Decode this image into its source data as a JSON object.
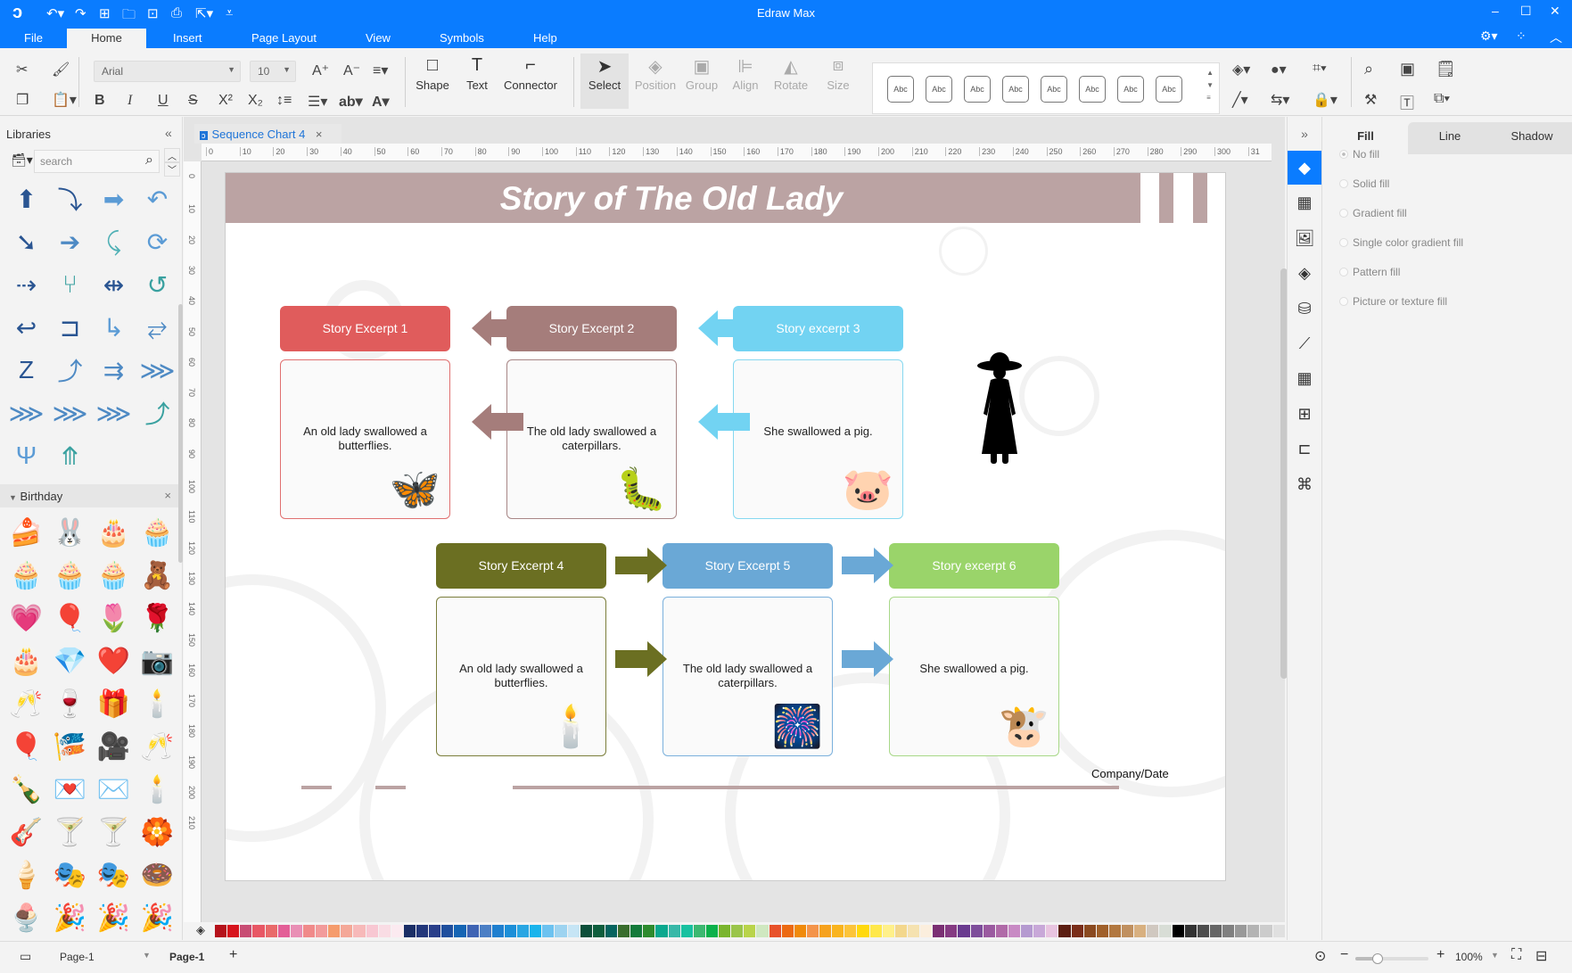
{
  "app": {
    "title": "Edraw Max"
  },
  "quick_access": [
    "app-logo-icon",
    "undo-icon",
    "redo-icon",
    "new-icon",
    "open-icon",
    "save-icon",
    "print-icon",
    "export-icon",
    "customize-icon"
  ],
  "menu": {
    "tabs": [
      "File",
      "Home",
      "Insert",
      "Page Layout",
      "View",
      "Symbols",
      "Help"
    ],
    "active": "Home"
  },
  "ribbon": {
    "font_name": "Arial",
    "font_size": "10",
    "tools": [
      {
        "label": "Shape",
        "glyph": "□",
        "enabled": true
      },
      {
        "label": "Text",
        "glyph": "T",
        "enabled": true
      },
      {
        "label": "Connector",
        "glyph": "⌐",
        "enabled": true
      },
      {
        "label": "Select",
        "glyph": "➤",
        "enabled": true
      },
      {
        "label": "Position",
        "glyph": "◈",
        "enabled": false
      },
      {
        "label": "Group",
        "glyph": "▣",
        "enabled": false
      },
      {
        "label": "Align",
        "glyph": "⊫",
        "enabled": false
      },
      {
        "label": "Rotate",
        "glyph": "◭",
        "enabled": false
      },
      {
        "label": "Size",
        "glyph": "⧈",
        "enabled": false
      }
    ],
    "style_preview_label": "Abc",
    "style_preview_count": 8
  },
  "libraries": {
    "title": "Libraries",
    "search_placeholder": "search",
    "arrows_section_count": 26,
    "birthday": {
      "title": "Birthday",
      "items": [
        "🍰",
        "🐰",
        "🎂",
        "🧁",
        "🧁",
        "🧁",
        "🧁",
        "🧸",
        "💗",
        "🎈",
        "🌷",
        "🌹",
        "🎂",
        "💎",
        "❤️",
        "📷",
        "🥂",
        "🍷",
        "🎁",
        "🕯️",
        "🎈",
        "🎏",
        "🎥",
        "🥂",
        "🍾",
        "💌",
        "✉️",
        "🕯️",
        "🎸",
        "🍸",
        "🍸",
        "🏵️",
        "🍦",
        "🎭",
        "🎭",
        "🍩",
        "🍨",
        "🎉",
        "🎉",
        "🎉"
      ]
    }
  },
  "document": {
    "tab_label": "Sequence Chart 4"
  },
  "rulers": {
    "horizontal": [
      "0",
      "10",
      "20",
      "30",
      "40",
      "50",
      "60",
      "70",
      "80",
      "90",
      "100",
      "110",
      "120",
      "130",
      "140",
      "150",
      "160",
      "170",
      "180",
      "190",
      "200",
      "210",
      "220",
      "230",
      "240",
      "250",
      "260",
      "270",
      "280",
      "290",
      "300",
      "31"
    ],
    "vertical": [
      "0",
      "10",
      "20",
      "30",
      "40",
      "50",
      "60",
      "70",
      "80",
      "90",
      "100",
      "110",
      "120",
      "130",
      "140",
      "150",
      "160",
      "170",
      "180",
      "190",
      "200",
      "210"
    ]
  },
  "diagram": {
    "title": "Story of The Old Lady",
    "band_color": "#bba3a3",
    "footer": "Company/Date",
    "row1": [
      {
        "header": "Story Excerpt 1",
        "text": "An old lady swallowed a butterflies.",
        "color": "#e05c5c",
        "border": "#e07070",
        "pic": "🦋"
      },
      {
        "header": "Story Excerpt 2",
        "text": "The old lady swallowed a caterpillars.",
        "color": "#a57d7b",
        "border": "#a88686",
        "pic": "🐛"
      },
      {
        "header": "Story excerpt 3",
        "text": "She swallowed a pig.",
        "color": "#72d3f2",
        "border": "#86d8f0",
        "pic": "🐷"
      }
    ],
    "row2": [
      {
        "header": "Story Excerpt 4",
        "text": "An old lady swallowed a butterflies.",
        "color": "#6b6f22",
        "border": "#7a7d3a",
        "pic": "🕯️"
      },
      {
        "header": "Story Excerpt 5",
        "text": "The old lady swallowed a caterpillars.",
        "color": "#6aa8d6",
        "border": "#7ab0dc",
        "pic": "🎆"
      },
      {
        "header": "Story excerpt 6",
        "text": "She swallowed a pig.",
        "color": "#9ad46a",
        "border": "#a8d888",
        "pic": "🐮"
      }
    ],
    "figure_icon": "old-lady-silhouette"
  },
  "right_strip_icons": [
    "fill-icon",
    "grid-icon",
    "image-icon",
    "layers-icon",
    "database-icon",
    "chart-icon",
    "table-icon",
    "org-icon",
    "timeline-icon",
    "mindmap-icon"
  ],
  "properties": {
    "tabs": [
      "Fill",
      "Line",
      "Shadow"
    ],
    "active_tab": "Fill",
    "fill_options": [
      "No fill",
      "Solid fill",
      "Gradient fill",
      "Single color gradient fill",
      "Pattern fill",
      "Picture or texture fill"
    ],
    "selected_fill": "No fill"
  },
  "palette": [
    "#b5121b",
    "#d7141d",
    "#c84d74",
    "#e85765",
    "#e96a6a",
    "#e35f97",
    "#e98fb5",
    "#f08a8a",
    "#f29b9b",
    "#f59c6d",
    "#f4a898",
    "#f7b9b9",
    "#f8c7d2",
    "#f9dce4",
    "#fbeaf0",
    "#1b2e66",
    "#23377b",
    "#2a3f8a",
    "#1f4f9e",
    "#1565b4",
    "#3f64b4",
    "#4b7fc5",
    "#1f7fcf",
    "#1c8fd8",
    "#29a6e3",
    "#1ab4ec",
    "#6cc2f0",
    "#9dd3f0",
    "#c6e5f5",
    "#0d4f3a",
    "#0e5e3d",
    "#06645f",
    "#3a6e2e",
    "#137a3a",
    "#2e8b2e",
    "#0aa88e",
    "#38b8a8",
    "#18c1a0",
    "#3cb871",
    "#0cb14b",
    "#7ab52e",
    "#9ac54a",
    "#b9d44a",
    "#cfe8c0",
    "#e8522a",
    "#ec6a12",
    "#f08a0a",
    "#f4944a",
    "#f6a21e",
    "#f9b41e",
    "#fcc43a",
    "#ffd90e",
    "#ffe84a",
    "#fff08a",
    "#f3d78c",
    "#f5e2b0",
    "#fbeedd",
    "#7a2f73",
    "#853a82",
    "#6a3b8f",
    "#7e4e9b",
    "#9b5aa0",
    "#b06aa8",
    "#c88ac4",
    "#b59ad0",
    "#c8a8d8",
    "#e8c4e0",
    "#5c1e12",
    "#7a2e1a",
    "#8b4a20",
    "#a0602a",
    "#b27840",
    "#c09060",
    "#d8b080",
    "#d0c8c0",
    "#d8ddd6",
    "#000000",
    "#333333",
    "#4d4d4d",
    "#666666",
    "#808080",
    "#999999",
    "#b3b3b3",
    "#cccccc",
    "#e0e0e0"
  ],
  "status": {
    "page_selector": "Page-1",
    "active_page": "Page-1",
    "zoom": "100%",
    "zoom_fraction": 0.3
  }
}
